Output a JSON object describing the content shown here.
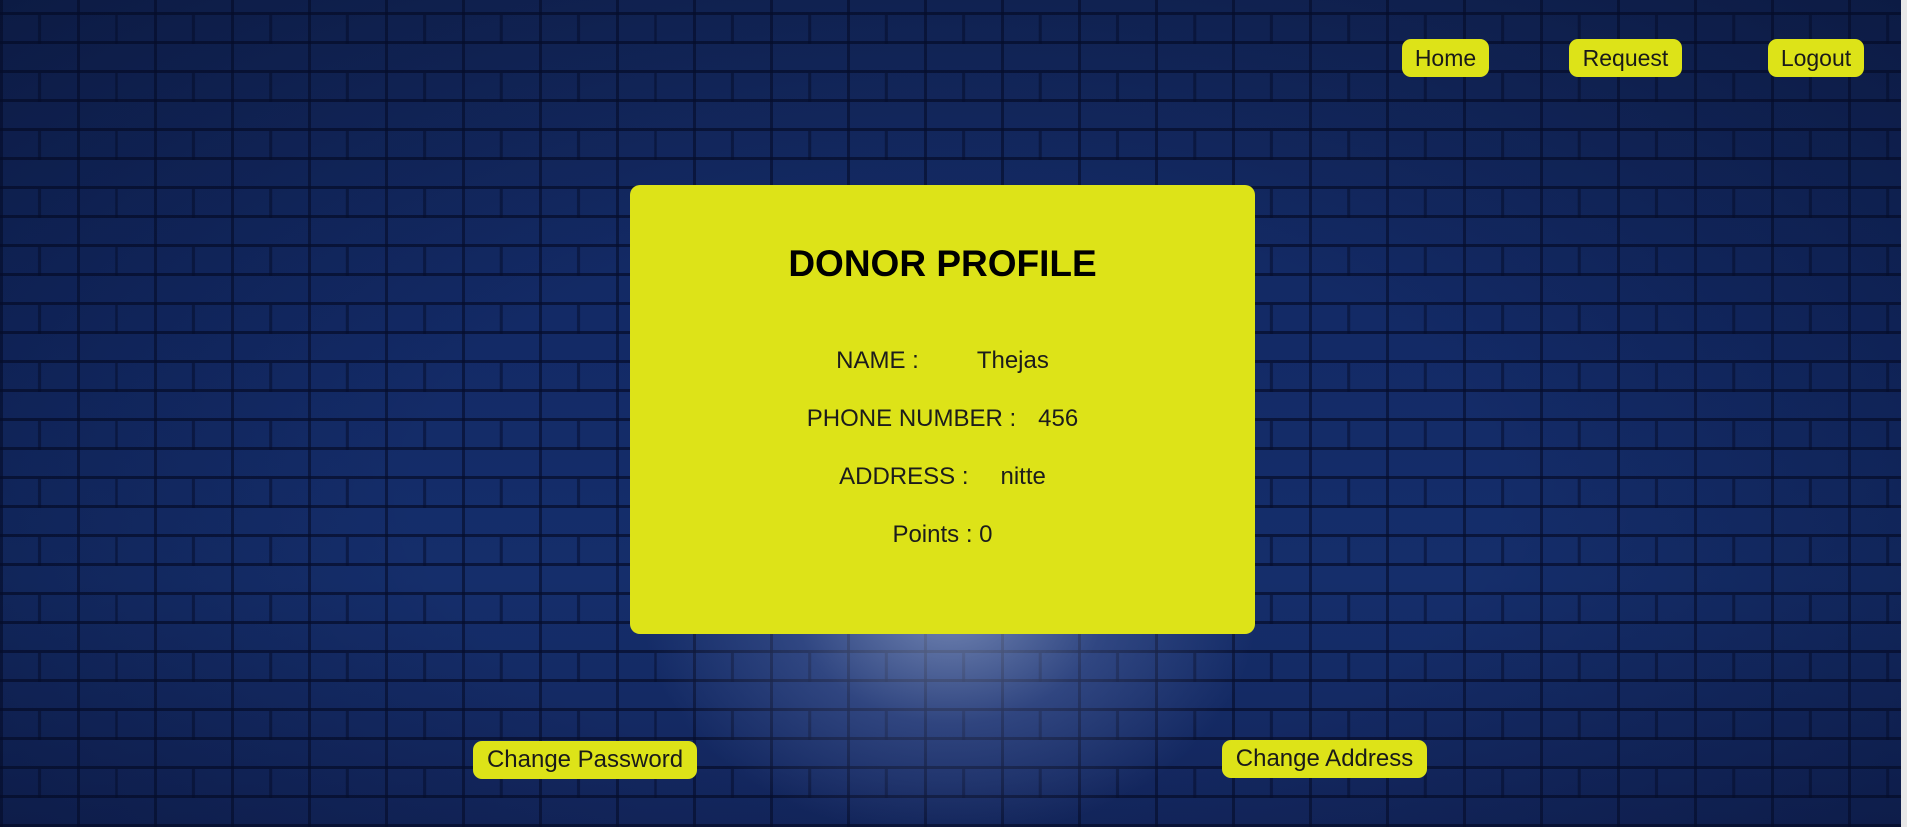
{
  "nav": {
    "home_label": "Home",
    "request_label": "Request",
    "logout_label": "Logout"
  },
  "profile": {
    "title": "DONOR PROFILE",
    "name_label": "NAME :",
    "name_value": "Thejas",
    "phone_label": "PHONE NUMBER :",
    "phone_value": "456",
    "address_label": "ADDRESS :",
    "address_value": "nitte",
    "points_label": "Points :",
    "points_value": "0"
  },
  "actions": {
    "change_password_label": "Change Password",
    "change_address_label": "Change Address"
  },
  "colors": {
    "accent": "#dde318",
    "background": "#132a66",
    "text": "#1c1c1c"
  }
}
